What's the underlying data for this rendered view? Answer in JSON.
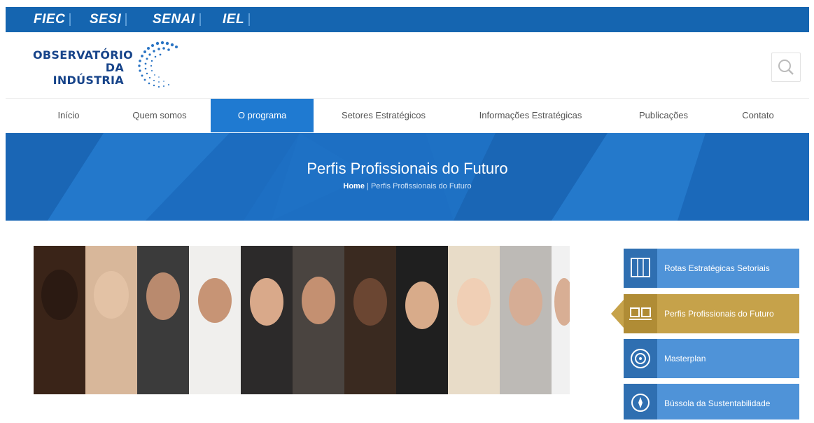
{
  "brands": [
    "FIEC",
    "SESI",
    "SENAI",
    "IEL"
  ],
  "logo": {
    "line1": "OBSERVATÓRIO",
    "line2": "DA INDÚSTRIA"
  },
  "search": {
    "icon": "search-icon"
  },
  "nav": {
    "items": [
      {
        "label": "Início"
      },
      {
        "label": "Quem somos"
      },
      {
        "label": "O programa"
      },
      {
        "label": "Setores Estratégicos"
      },
      {
        "label": "Informações Estratégicas"
      },
      {
        "label": "Publicações"
      },
      {
        "label": "Contato"
      }
    ],
    "active_index": 2
  },
  "banner": {
    "title": "Perfis Profissionais do Futuro",
    "breadcrumb_home": "Home",
    "breadcrumb_sep": "|",
    "breadcrumb_current": "Perfis Profissionais do Futuro"
  },
  "sidebar": {
    "items": [
      {
        "label": "Rotas Estratégicas Setoriais",
        "icon": "map-icon"
      },
      {
        "label": "Perfis Profissionais do Futuro",
        "icon": "people-icon"
      },
      {
        "label": "Masterplan",
        "icon": "target-icon"
      },
      {
        "label": "Bússola da Sustentabilidade",
        "icon": "compass-icon"
      }
    ],
    "active_index": 1
  },
  "colors": {
    "brand_blue": "#1565b0",
    "nav_active": "#1f7ad1",
    "banner_blue": "#1d6fc3",
    "side_blue": "#4f93d8",
    "side_gold": "#c6a24a"
  }
}
